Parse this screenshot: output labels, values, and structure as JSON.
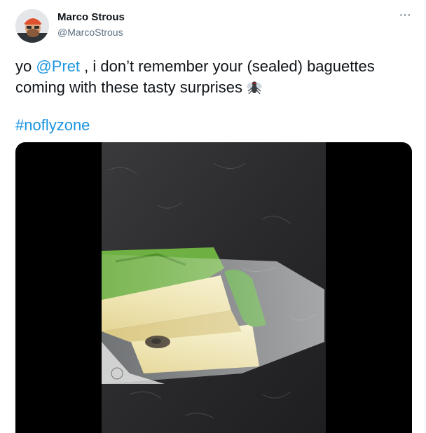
{
  "tweet": {
    "author_name": "Marco Strous",
    "author_handle": "@MarcoStrous",
    "more_icon": "more-dots-icon",
    "text_prefix": "yo ",
    "mention": "@Pret",
    "text_rest": " , i don’t remember your (sealed) baguettes coming with these tasty surprises",
    "emoji": "fly-icon",
    "hashtag": "#noflyzone"
  },
  "colors": {
    "link": "#1b95e0",
    "text": "#0f1419",
    "secondary": "#5b7083"
  }
}
